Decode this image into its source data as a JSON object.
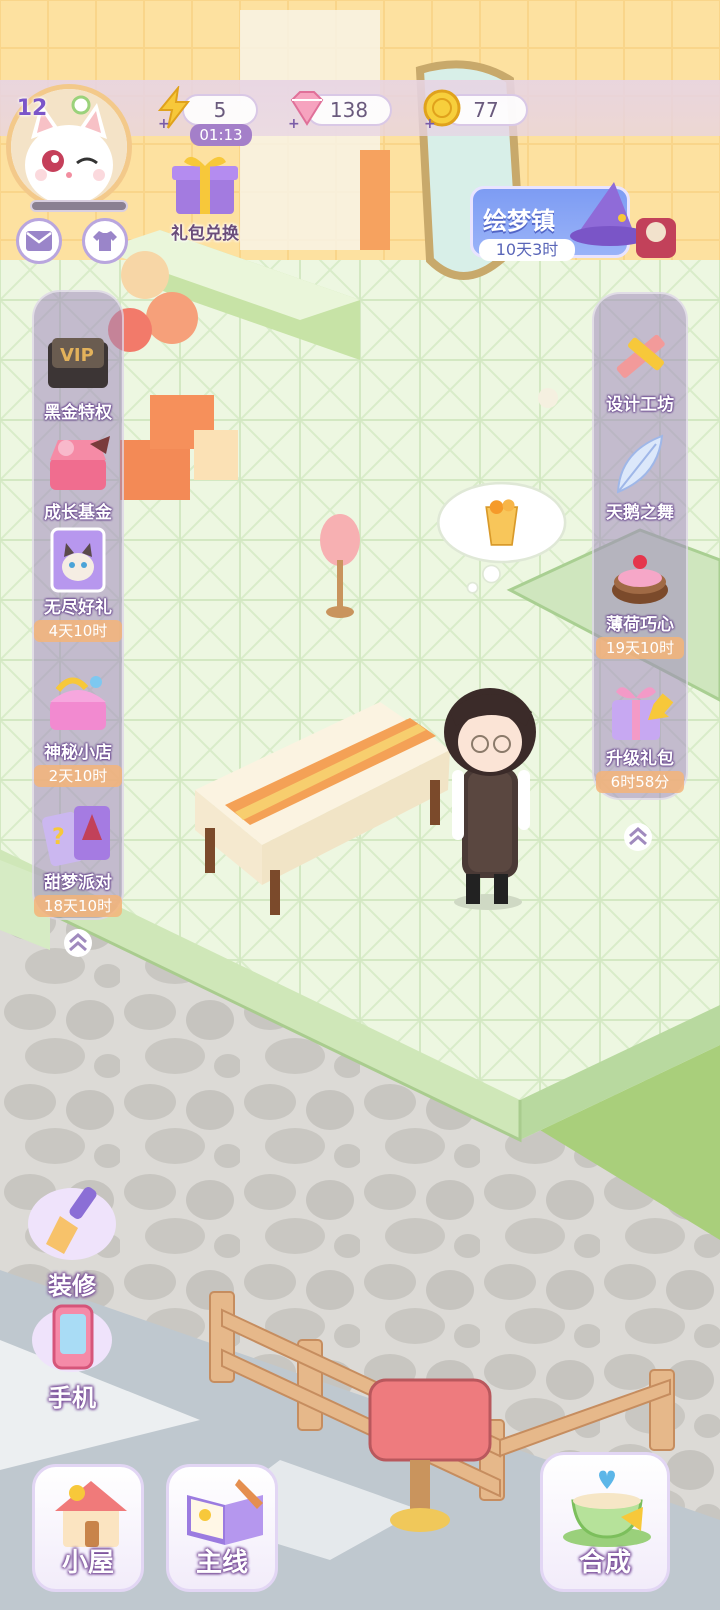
{
  "player": {
    "level": "12",
    "xp_progress": 0.0
  },
  "resources": {
    "energy": "5",
    "energy_timer": "01:13",
    "gems": "138",
    "coins": "77"
  },
  "gift_exchange_label": "礼包兑换",
  "event": {
    "title": "绘梦镇",
    "timer": "10天3时"
  },
  "left_menu": [
    {
      "label": "黑金特权",
      "timer": ""
    },
    {
      "label": "成长基金",
      "timer": ""
    },
    {
      "label": "无尽好礼",
      "timer": "4天10时"
    },
    {
      "label": "神秘小店",
      "timer": "2天10时"
    },
    {
      "label": "甜梦派对",
      "timer": "18天10时"
    }
  ],
  "vip_badge": "VIP",
  "right_menu": [
    {
      "label": "设计工坊",
      "timer": ""
    },
    {
      "label": "天鹅之舞",
      "timer": ""
    },
    {
      "label": "薄荷巧心",
      "timer": "19天10时"
    },
    {
      "label": "升级礼包",
      "timer": "6时58分"
    }
  ],
  "bottom_left": {
    "decorate": "装修",
    "phone": "手机"
  },
  "bottom_bar": {
    "house": "小屋",
    "mainline": "主线",
    "merge": "合成"
  },
  "colors": {
    "floor": "#eaf6dc",
    "floor_grid": "#d2e9c0",
    "platform_edge": "#b7d9a0",
    "wall": "#fde6a7",
    "stone": "#c7c5c0",
    "panel": "#a08abe"
  }
}
